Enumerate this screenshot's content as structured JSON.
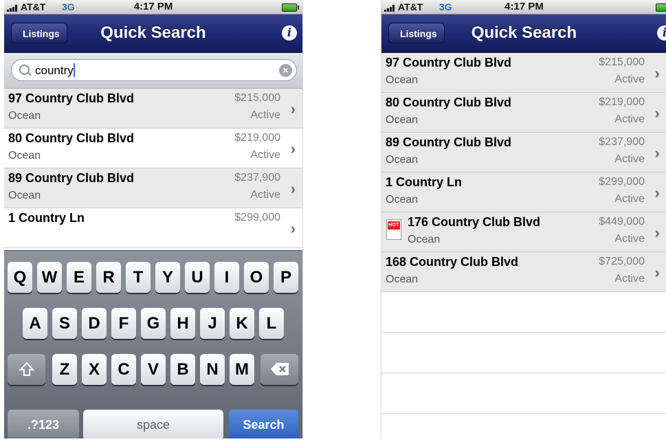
{
  "status_bar": {
    "carrier": "AT&T",
    "network": "3G",
    "time": "4:17 PM"
  },
  "nav": {
    "back_label": "Listings",
    "title": "Quick Search"
  },
  "search": {
    "value": "country"
  },
  "listings": [
    {
      "address": "97 Country Club Blvd",
      "city": "Ocean",
      "price": "$215,000",
      "status": "Active",
      "hot": false
    },
    {
      "address": "80 Country Club Blvd",
      "city": "Ocean",
      "price": "$219,000",
      "status": "Active",
      "hot": false
    },
    {
      "address": "89 Country Club Blvd",
      "city": "Ocean",
      "price": "$237,900",
      "status": "Active",
      "hot": false
    },
    {
      "address": "1 Country Ln",
      "city": "Ocean",
      "price": "$299,000",
      "status": "Active",
      "hot": false
    },
    {
      "address": "176 Country Club Blvd",
      "city": "Ocean",
      "price": "$449,000",
      "status": "Active",
      "hot": true
    },
    {
      "address": "168 Country Club Blvd",
      "city": "Ocean",
      "price": "$725,000",
      "status": "Active",
      "hot": false
    }
  ],
  "hot_badge": "HOT",
  "keyboard": {
    "row1": [
      "Q",
      "W",
      "E",
      "R",
      "T",
      "Y",
      "U",
      "I",
      "O",
      "P"
    ],
    "row2": [
      "A",
      "S",
      "D",
      "F",
      "G",
      "H",
      "J",
      "K",
      "L"
    ],
    "row3": [
      "Z",
      "X",
      "C",
      "V",
      "B",
      "N",
      "M"
    ],
    "numbers_label": ".?123",
    "space_label": "space",
    "search_label": "Search"
  },
  "icons": {
    "signal": "signal-bars-icon",
    "battery": "battery-icon",
    "info": "info-icon",
    "search": "magnifier-icon",
    "clear": "clear-icon",
    "chevron": "chevron-right-icon",
    "shift": "shift-icon",
    "backspace": "backspace-icon"
  },
  "colors": {
    "navbar": "#1e2a73",
    "network": "#2d64c8",
    "search_key": "#2b5fc0",
    "hot": "#dd2222"
  }
}
